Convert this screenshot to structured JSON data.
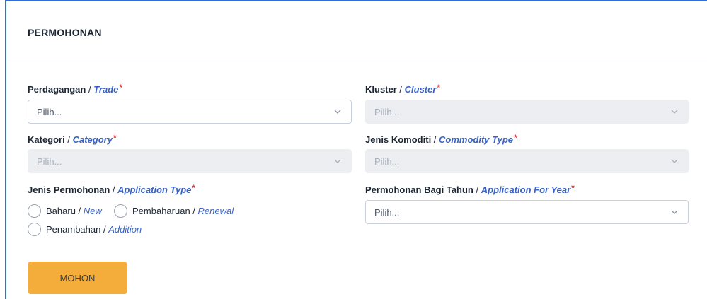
{
  "card": {
    "title": "PERMOHONAN"
  },
  "fields": {
    "trade": {
      "label": "Perdagangan",
      "sep": " / ",
      "label_en": "Trade",
      "required": "*",
      "placeholder": "Pilih..."
    },
    "cluster": {
      "label": "Kluster",
      "sep": " / ",
      "label_en": "Cluster",
      "required": "*",
      "placeholder": "Pilih..."
    },
    "category": {
      "label": "Kategori",
      "sep": " / ",
      "label_en": "Category",
      "required": "*",
      "placeholder": "Pilih..."
    },
    "commodity": {
      "label": "Jenis Komoditi",
      "sep": " / ",
      "label_en": "Commodity Type",
      "required": "*",
      "placeholder": "Pilih..."
    },
    "app_type": {
      "label": "Jenis Permohonan",
      "sep": " / ",
      "label_en": "Application Type",
      "required": "*"
    },
    "app_year": {
      "label": "Permohonan Bagi Tahun",
      "sep": " / ",
      "label_en": "Application For Year",
      "required": "*",
      "placeholder": "Pilih..."
    }
  },
  "radios": [
    {
      "label": "Baharu",
      "sep": " / ",
      "label_en": "New"
    },
    {
      "label": "Pembaharuan",
      "sep": " / ",
      "label_en": "Renewal"
    },
    {
      "label": "Penambahan",
      "sep": " / ",
      "label_en": "Addition"
    }
  ],
  "submit": {
    "label": "MOHON"
  },
  "colors": {
    "accent": "#f4ad3a",
    "link": "#3a62c2",
    "required": "#e0343c",
    "frame": "#2f6fd6"
  },
  "icons": {
    "select_caret": "chevron-down-icon"
  }
}
